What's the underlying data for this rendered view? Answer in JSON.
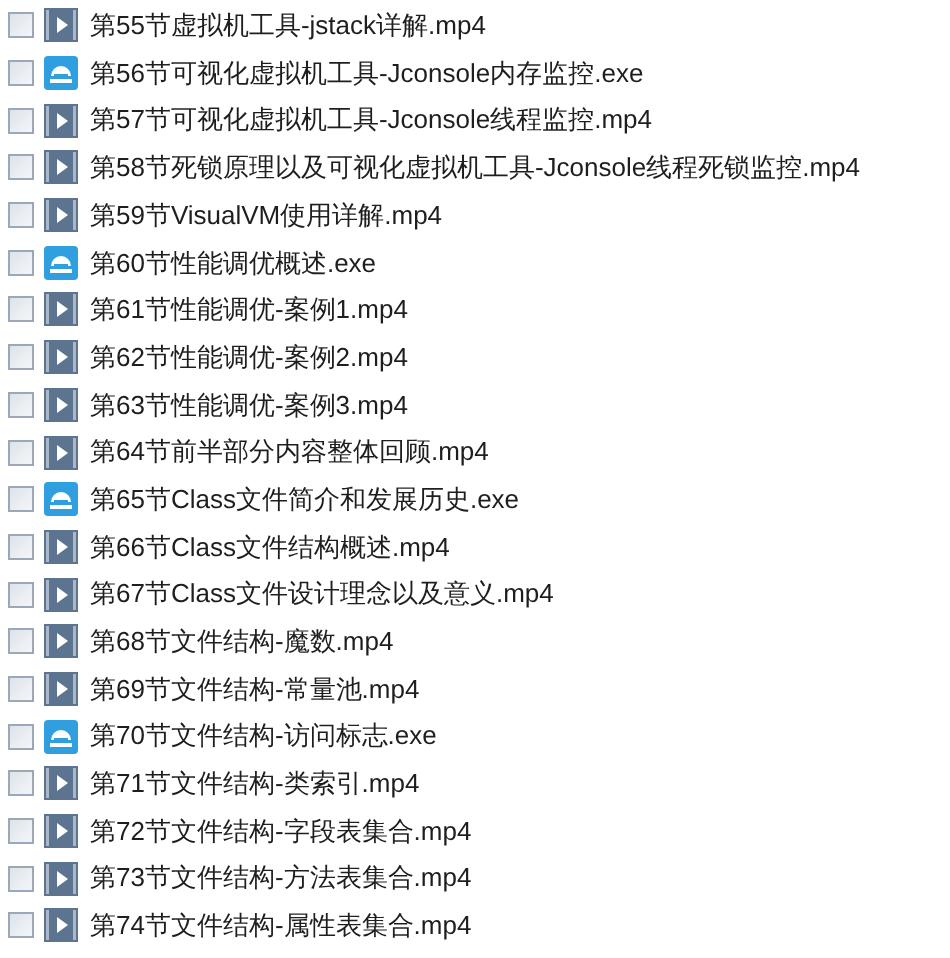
{
  "files": [
    {
      "name": "第55节虚拟机工具-jstack详解.mp4",
      "kind": "video",
      "checked": false
    },
    {
      "name": "第56节可视化虚拟机工具-Jconsole内存监控.exe",
      "kind": "exe",
      "checked": false
    },
    {
      "name": "第57节可视化虚拟机工具-Jconsole线程监控.mp4",
      "kind": "video",
      "checked": false
    },
    {
      "name": "第58节死锁原理以及可视化虚拟机工具-Jconsole线程死锁监控.mp4",
      "kind": "video",
      "checked": false
    },
    {
      "name": "第59节VisualVM使用详解.mp4",
      "kind": "video",
      "checked": false
    },
    {
      "name": "第60节性能调优概述.exe",
      "kind": "exe",
      "checked": false
    },
    {
      "name": "第61节性能调优-案例1.mp4",
      "kind": "video",
      "checked": false
    },
    {
      "name": "第62节性能调优-案例2.mp4",
      "kind": "video",
      "checked": false
    },
    {
      "name": "第63节性能调优-案例3.mp4",
      "kind": "video",
      "checked": false
    },
    {
      "name": "第64节前半部分内容整体回顾.mp4",
      "kind": "video",
      "checked": false
    },
    {
      "name": "第65节Class文件简介和发展历史.exe",
      "kind": "exe",
      "checked": false
    },
    {
      "name": "第66节Class文件结构概述.mp4",
      "kind": "video",
      "checked": false
    },
    {
      "name": "第67节Class文件设计理念以及意义.mp4",
      "kind": "video",
      "checked": false
    },
    {
      "name": "第68节文件结构-魔数.mp4",
      "kind": "video",
      "checked": false
    },
    {
      "name": "第69节文件结构-常量池.mp4",
      "kind": "video",
      "checked": false
    },
    {
      "name": "第70节文件结构-访问标志.exe",
      "kind": "exe",
      "checked": false
    },
    {
      "name": "第71节文件结构-类索引.mp4",
      "kind": "video",
      "checked": false
    },
    {
      "name": "第72节文件结构-字段表集合.mp4",
      "kind": "video",
      "checked": false
    },
    {
      "name": "第73节文件结构-方法表集合.mp4",
      "kind": "video",
      "checked": false
    },
    {
      "name": "第74节文件结构-属性表集合.mp4",
      "kind": "video",
      "checked": false
    }
  ]
}
